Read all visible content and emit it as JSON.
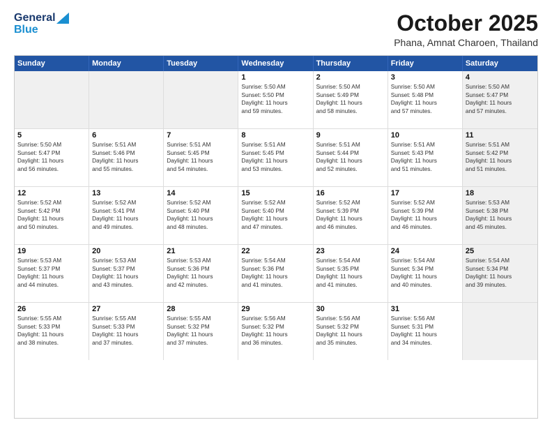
{
  "header": {
    "logo_general": "General",
    "logo_blue": "Blue",
    "title": "October 2025",
    "subtitle": "Phana, Amnat Charoen, Thailand"
  },
  "weekdays": [
    "Sunday",
    "Monday",
    "Tuesday",
    "Wednesday",
    "Thursday",
    "Friday",
    "Saturday"
  ],
  "weeks": [
    [
      {
        "day": "",
        "lines": [],
        "shaded": true
      },
      {
        "day": "",
        "lines": [],
        "shaded": true
      },
      {
        "day": "",
        "lines": [],
        "shaded": true
      },
      {
        "day": "1",
        "lines": [
          "Sunrise: 5:50 AM",
          "Sunset: 5:50 PM",
          "Daylight: 11 hours",
          "and 59 minutes."
        ],
        "shaded": false
      },
      {
        "day": "2",
        "lines": [
          "Sunrise: 5:50 AM",
          "Sunset: 5:49 PM",
          "Daylight: 11 hours",
          "and 58 minutes."
        ],
        "shaded": false
      },
      {
        "day": "3",
        "lines": [
          "Sunrise: 5:50 AM",
          "Sunset: 5:48 PM",
          "Daylight: 11 hours",
          "and 57 minutes."
        ],
        "shaded": false
      },
      {
        "day": "4",
        "lines": [
          "Sunrise: 5:50 AM",
          "Sunset: 5:47 PM",
          "Daylight: 11 hours",
          "and 57 minutes."
        ],
        "shaded": true
      }
    ],
    [
      {
        "day": "5",
        "lines": [
          "Sunrise: 5:50 AM",
          "Sunset: 5:47 PM",
          "Daylight: 11 hours",
          "and 56 minutes."
        ],
        "shaded": false
      },
      {
        "day": "6",
        "lines": [
          "Sunrise: 5:51 AM",
          "Sunset: 5:46 PM",
          "Daylight: 11 hours",
          "and 55 minutes."
        ],
        "shaded": false
      },
      {
        "day": "7",
        "lines": [
          "Sunrise: 5:51 AM",
          "Sunset: 5:45 PM",
          "Daylight: 11 hours",
          "and 54 minutes."
        ],
        "shaded": false
      },
      {
        "day": "8",
        "lines": [
          "Sunrise: 5:51 AM",
          "Sunset: 5:45 PM",
          "Daylight: 11 hours",
          "and 53 minutes."
        ],
        "shaded": false
      },
      {
        "day": "9",
        "lines": [
          "Sunrise: 5:51 AM",
          "Sunset: 5:44 PM",
          "Daylight: 11 hours",
          "and 52 minutes."
        ],
        "shaded": false
      },
      {
        "day": "10",
        "lines": [
          "Sunrise: 5:51 AM",
          "Sunset: 5:43 PM",
          "Daylight: 11 hours",
          "and 51 minutes."
        ],
        "shaded": false
      },
      {
        "day": "11",
        "lines": [
          "Sunrise: 5:51 AM",
          "Sunset: 5:42 PM",
          "Daylight: 11 hours",
          "and 51 minutes."
        ],
        "shaded": true
      }
    ],
    [
      {
        "day": "12",
        "lines": [
          "Sunrise: 5:52 AM",
          "Sunset: 5:42 PM",
          "Daylight: 11 hours",
          "and 50 minutes."
        ],
        "shaded": false
      },
      {
        "day": "13",
        "lines": [
          "Sunrise: 5:52 AM",
          "Sunset: 5:41 PM",
          "Daylight: 11 hours",
          "and 49 minutes."
        ],
        "shaded": false
      },
      {
        "day": "14",
        "lines": [
          "Sunrise: 5:52 AM",
          "Sunset: 5:40 PM",
          "Daylight: 11 hours",
          "and 48 minutes."
        ],
        "shaded": false
      },
      {
        "day": "15",
        "lines": [
          "Sunrise: 5:52 AM",
          "Sunset: 5:40 PM",
          "Daylight: 11 hours",
          "and 47 minutes."
        ],
        "shaded": false
      },
      {
        "day": "16",
        "lines": [
          "Sunrise: 5:52 AM",
          "Sunset: 5:39 PM",
          "Daylight: 11 hours",
          "and 46 minutes."
        ],
        "shaded": false
      },
      {
        "day": "17",
        "lines": [
          "Sunrise: 5:52 AM",
          "Sunset: 5:39 PM",
          "Daylight: 11 hours",
          "and 46 minutes."
        ],
        "shaded": false
      },
      {
        "day": "18",
        "lines": [
          "Sunrise: 5:53 AM",
          "Sunset: 5:38 PM",
          "Daylight: 11 hours",
          "and 45 minutes."
        ],
        "shaded": true
      }
    ],
    [
      {
        "day": "19",
        "lines": [
          "Sunrise: 5:53 AM",
          "Sunset: 5:37 PM",
          "Daylight: 11 hours",
          "and 44 minutes."
        ],
        "shaded": false
      },
      {
        "day": "20",
        "lines": [
          "Sunrise: 5:53 AM",
          "Sunset: 5:37 PM",
          "Daylight: 11 hours",
          "and 43 minutes."
        ],
        "shaded": false
      },
      {
        "day": "21",
        "lines": [
          "Sunrise: 5:53 AM",
          "Sunset: 5:36 PM",
          "Daylight: 11 hours",
          "and 42 minutes."
        ],
        "shaded": false
      },
      {
        "day": "22",
        "lines": [
          "Sunrise: 5:54 AM",
          "Sunset: 5:36 PM",
          "Daylight: 11 hours",
          "and 41 minutes."
        ],
        "shaded": false
      },
      {
        "day": "23",
        "lines": [
          "Sunrise: 5:54 AM",
          "Sunset: 5:35 PM",
          "Daylight: 11 hours",
          "and 41 minutes."
        ],
        "shaded": false
      },
      {
        "day": "24",
        "lines": [
          "Sunrise: 5:54 AM",
          "Sunset: 5:34 PM",
          "Daylight: 11 hours",
          "and 40 minutes."
        ],
        "shaded": false
      },
      {
        "day": "25",
        "lines": [
          "Sunrise: 5:54 AM",
          "Sunset: 5:34 PM",
          "Daylight: 11 hours",
          "and 39 minutes."
        ],
        "shaded": true
      }
    ],
    [
      {
        "day": "26",
        "lines": [
          "Sunrise: 5:55 AM",
          "Sunset: 5:33 PM",
          "Daylight: 11 hours",
          "and 38 minutes."
        ],
        "shaded": false
      },
      {
        "day": "27",
        "lines": [
          "Sunrise: 5:55 AM",
          "Sunset: 5:33 PM",
          "Daylight: 11 hours",
          "and 37 minutes."
        ],
        "shaded": false
      },
      {
        "day": "28",
        "lines": [
          "Sunrise: 5:55 AM",
          "Sunset: 5:32 PM",
          "Daylight: 11 hours",
          "and 37 minutes."
        ],
        "shaded": false
      },
      {
        "day": "29",
        "lines": [
          "Sunrise: 5:56 AM",
          "Sunset: 5:32 PM",
          "Daylight: 11 hours",
          "and 36 minutes."
        ],
        "shaded": false
      },
      {
        "day": "30",
        "lines": [
          "Sunrise: 5:56 AM",
          "Sunset: 5:32 PM",
          "Daylight: 11 hours",
          "and 35 minutes."
        ],
        "shaded": false
      },
      {
        "day": "31",
        "lines": [
          "Sunrise: 5:56 AM",
          "Sunset: 5:31 PM",
          "Daylight: 11 hours",
          "and 34 minutes."
        ],
        "shaded": false
      },
      {
        "day": "",
        "lines": [],
        "shaded": true
      }
    ]
  ]
}
